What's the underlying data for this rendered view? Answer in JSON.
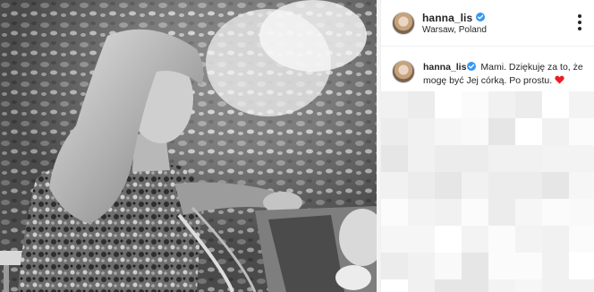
{
  "post": {
    "username": "hanna_lis",
    "location": "Warsaw, Poland",
    "caption_username": "hanna_lis",
    "caption_text": "Mami. Dziękuję za to, że mogę być Jej córką. Po prostu.",
    "caption_emoji": "red-heart"
  },
  "icons": {
    "verified": "verified-badge-icon",
    "more": "more-options-icon",
    "heart": "red-heart-emoji"
  },
  "colors": {
    "verified_blue": "#3897f0",
    "heart_red": "#ed1c24",
    "text": "#262626",
    "border": "#efefef"
  }
}
